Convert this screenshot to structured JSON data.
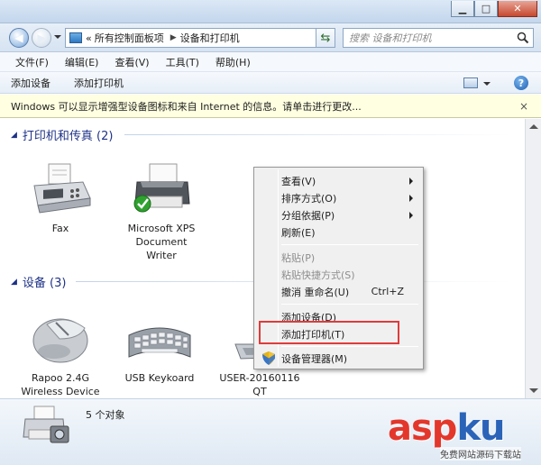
{
  "window": {
    "title_ghost": "",
    "controls": {
      "minimize": "▁",
      "maximize": "□",
      "close": "✕"
    }
  },
  "address_bar": {
    "prefix": "«",
    "segments": [
      "所有控制面板项",
      "设备和打印机"
    ],
    "search_placeholder": "搜索 设备和打印机"
  },
  "menu": [
    "文件(F)",
    "编辑(E)",
    "查看(V)",
    "工具(T)",
    "帮助(H)"
  ],
  "commands": [
    "添加设备",
    "添加打印机"
  ],
  "infobar": {
    "text": "Windows 可以显示增强型设备图标和来自 Internet 的信息。请单击进行更改...",
    "close": "×"
  },
  "groups": [
    {
      "title": "打印机和传真 (2)"
    },
    {
      "title": "设备 (3)"
    }
  ],
  "printers": [
    {
      "name": "Fax",
      "icon": "fax-icon"
    },
    {
      "name": "Microsoft XPS Document Writer",
      "icon": "printer-icon",
      "lines": [
        "Microsoft XPS",
        "Document",
        "Writer"
      ]
    }
  ],
  "devices": [
    {
      "lines": [
        "Rapoo 2.4G",
        "Wireless Device"
      ],
      "icon": "mouse-icon"
    },
    {
      "lines": [
        "USB Keykoard"
      ],
      "icon": "keyboard-icon"
    },
    {
      "lines": [
        "USER-20160116",
        "QT"
      ],
      "icon": "laptop-icon"
    }
  ],
  "context_menu": {
    "items": [
      {
        "label": "查看(V)",
        "submenu": true
      },
      {
        "label": "排序方式(O)",
        "submenu": true
      },
      {
        "label": "分组依据(P)",
        "submenu": true
      },
      {
        "label": "刷新(E)"
      },
      {
        "label": "粘贴(P)",
        "disabled": true
      },
      {
        "label": "粘贴快捷方式(S)",
        "disabled": true
      },
      {
        "label": "撤消 重命名(U)",
        "shortcut": "Ctrl+Z"
      },
      {
        "label": "添加设备(D)"
      },
      {
        "label": "添加打印机(T)",
        "highlighted": true
      },
      {
        "label": "设备管理器(M)",
        "icon": "shield-icon"
      }
    ]
  },
  "status": {
    "text": "5 个对象"
  },
  "watermark": {
    "asp": "asp",
    "ku": "ku",
    "com": ".com",
    "sub": "免费网站源码下载站"
  },
  "colors": {
    "group_title": "#1e3287",
    "highlight_box": "#e03b3b",
    "infobar_bg": "#ffffe1"
  }
}
